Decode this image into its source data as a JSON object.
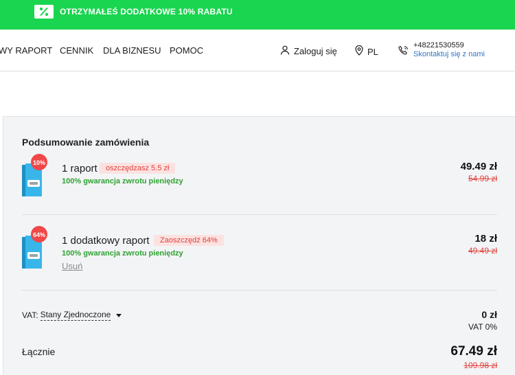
{
  "promo": {
    "text": "OTRZYMAŁEŚ DODATKOWE 10% RABATU",
    "icon": "percent-icon"
  },
  "nav": {
    "links": [
      "WY RAPORT",
      "CENNIK",
      "DLA BIZNESU",
      "POMOC"
    ],
    "login": "Zaloguj się",
    "language": "PL",
    "phone": "+48221530559",
    "contact_link": "Skontaktuj się z nami"
  },
  "summary": {
    "title": "Podsumowanie zamówienia",
    "items": [
      {
        "badge": "10%",
        "name": "1 raport",
        "savings": "oszczędzasz 5.5 zł",
        "guarantee": "100% gwarancja zwrotu pieniędzy",
        "price": "49.49 zł",
        "old_price": "54.99 zł"
      },
      {
        "badge": "64%",
        "name": "1 dodatkowy raport",
        "savings": "Zaoszczędź 64%",
        "guarantee": "100% gwarancja zwrotu pieniędzy",
        "remove": "Usuń",
        "price": "18 zł",
        "old_price": "49.49 zł"
      }
    ],
    "vat": {
      "label": "VAT:",
      "country": "Stany Zjednoczone",
      "amount": "0 zł",
      "rate": "VAT 0%"
    },
    "total": {
      "label": "Łącznie",
      "price": "67.49 zł",
      "old_price": "109.98 zł"
    }
  },
  "colors": {
    "brand_green": "#19d54f",
    "discount_red": "#e0413b",
    "guarantee_green": "#2ea232",
    "link_blue": "#2f73c4"
  }
}
